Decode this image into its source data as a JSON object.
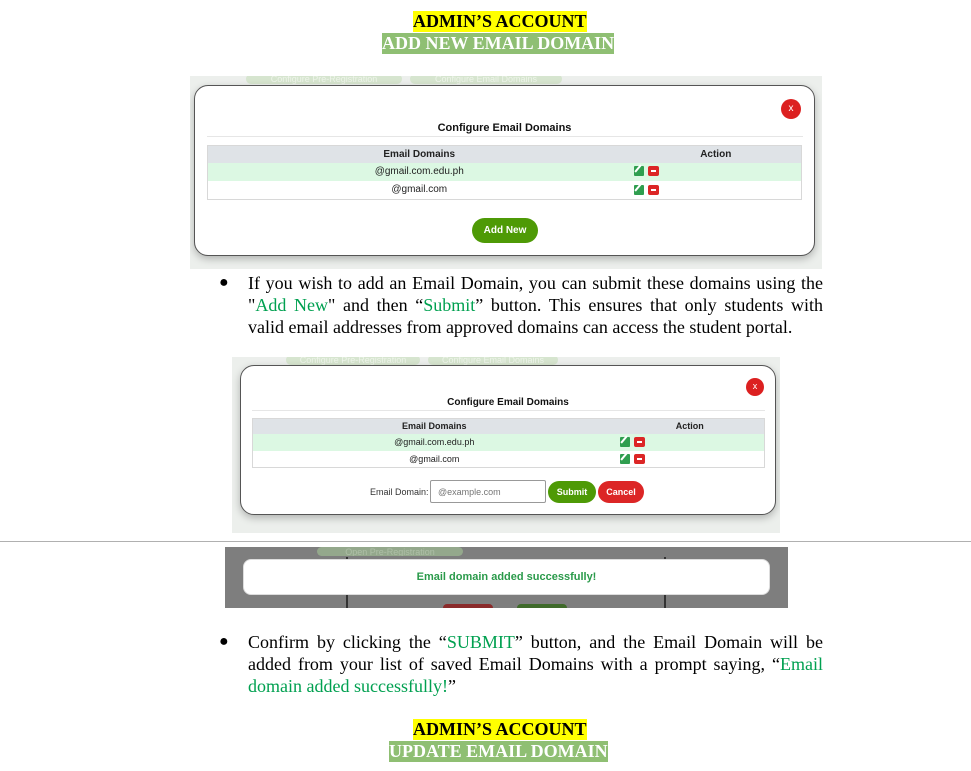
{
  "header_top": {
    "line1": "ADMIN’S ACCOUNT",
    "line2": "ADD NEW EMAIL DOMAIN"
  },
  "header_bottom": {
    "line1": "ADMIN’S ACCOUNT",
    "line2": "UPDATE EMAIL DOMAIN"
  },
  "background_buttons": [
    "Configure Pre-Registration",
    "Configure Email Domains",
    "Open Pre-Registration"
  ],
  "modal": {
    "close_label": "x",
    "title": "Configure Email Domains",
    "col_domains": "Email Domains",
    "col_action": "Action",
    "rows": [
      "@gmail.com.edu.ph",
      "@gmail.com"
    ],
    "add_new_label": "Add New",
    "email_domain_label": "Email Domain:",
    "email_placeholder": "@example.com",
    "submit_label": "Submit",
    "cancel_label": "Cancel"
  },
  "toast": {
    "message": "Email domain added successfully!"
  },
  "para1": {
    "t1": "If you wish to add an Email Domain, you can submit these domains using the \"",
    "g1": "Add New",
    "t2": "\" and then “",
    "g2": "Submit",
    "t3": "” button. This ensures that only students with valid email addresses from approved domains can access the student portal."
  },
  "para2": {
    "t1": "Confirm by clicking the “",
    "g1": "SUBMIT",
    "t2": "” button, and the Email Domain will be added from your list of saved Email Domains with a prompt saying, “",
    "g2": "Email domain added successfully!",
    "t3": "”"
  },
  "colors": {
    "accent_green": "#4e9a06",
    "danger_red": "#dc2626",
    "text_green": "#00a050",
    "highlight_yellow": "#ffff00",
    "highlight_green": "#8fbf73"
  }
}
